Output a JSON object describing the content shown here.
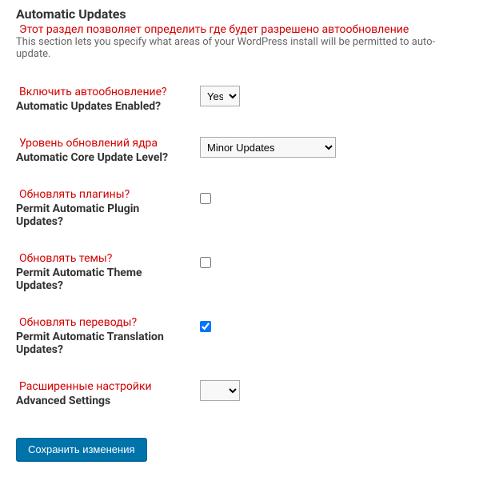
{
  "section": {
    "title": "Automatic Updates",
    "note_ru": "Этот раздел позволяет определить где будет разрешено автообновление",
    "note_en": "This section lets you specify what areas of your WordPress install will be permitted to auto-update."
  },
  "fields": {
    "enabled": {
      "label_ru": "Включить автообновление?",
      "label_en": "Automatic Updates Enabled?",
      "value": "Yes"
    },
    "core_level": {
      "label_ru": "Уровень обновлений ядра",
      "label_en": "Automatic Core Update Level?",
      "value": "Minor Updates"
    },
    "plugins": {
      "label_ru": "Обновлять плагины?",
      "label_en": "Permit Automatic Plugin Updates?"
    },
    "themes": {
      "label_ru": "Обновлять темы?",
      "label_en": "Permit Automatic Theme Updates?"
    },
    "translations": {
      "label_ru": "Обновлять переводы?",
      "label_en": "Permit Automatic Translation Updates?"
    },
    "advanced": {
      "label_ru": "Расширенные настройки",
      "label_en": "Advanced Settings",
      "value": ""
    }
  },
  "submit": {
    "label": "Сохранить изменения"
  }
}
